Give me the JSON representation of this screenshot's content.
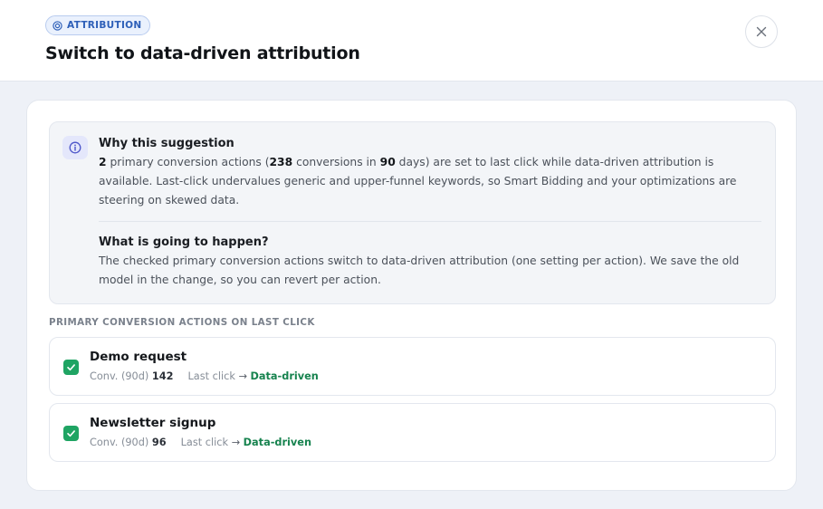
{
  "header": {
    "badge": "ATTRIBUTION",
    "badge_icon": "target-icon",
    "title": "Switch to data-driven attribution",
    "close_icon": "close-icon"
  },
  "info": {
    "icon": "info-icon",
    "why_title": "Why this suggestion",
    "why": {
      "count": "2",
      "t1": " primary conversion actions (",
      "conversions": "238",
      "t2": " conversions in ",
      "days": "90",
      "t3": " days) are set to last click while data-driven attribution is available. Last-click undervalues generic and upper-funnel keywords, so Smart Bidding and your optimizations are steering on skewed data."
    },
    "what_title": "What is going to happen?",
    "what_text": "The checked primary conversion actions switch to data-driven attribution (one setting per action). We save the old model in the change, so you can revert per action."
  },
  "section_label": "PRIMARY CONVERSION ACTIONS ON LAST CLICK",
  "actions": [
    {
      "name": "Demo request",
      "checked": true,
      "conv_label": "Conv. (90d) ",
      "conv_value": "142",
      "from": "Last click ",
      "arrow": "→",
      "to": "Data-driven"
    },
    {
      "name": "Newsletter signup",
      "checked": true,
      "conv_label": "Conv. (90d) ",
      "conv_value": "96",
      "from": "Last click ",
      "arrow": "→",
      "to": "Data-driven"
    }
  ],
  "colors": {
    "accent_blue": "#2d5fb8",
    "check_green": "#1fa463",
    "target_green": "#17834f",
    "page_bg": "#eef1f7"
  }
}
